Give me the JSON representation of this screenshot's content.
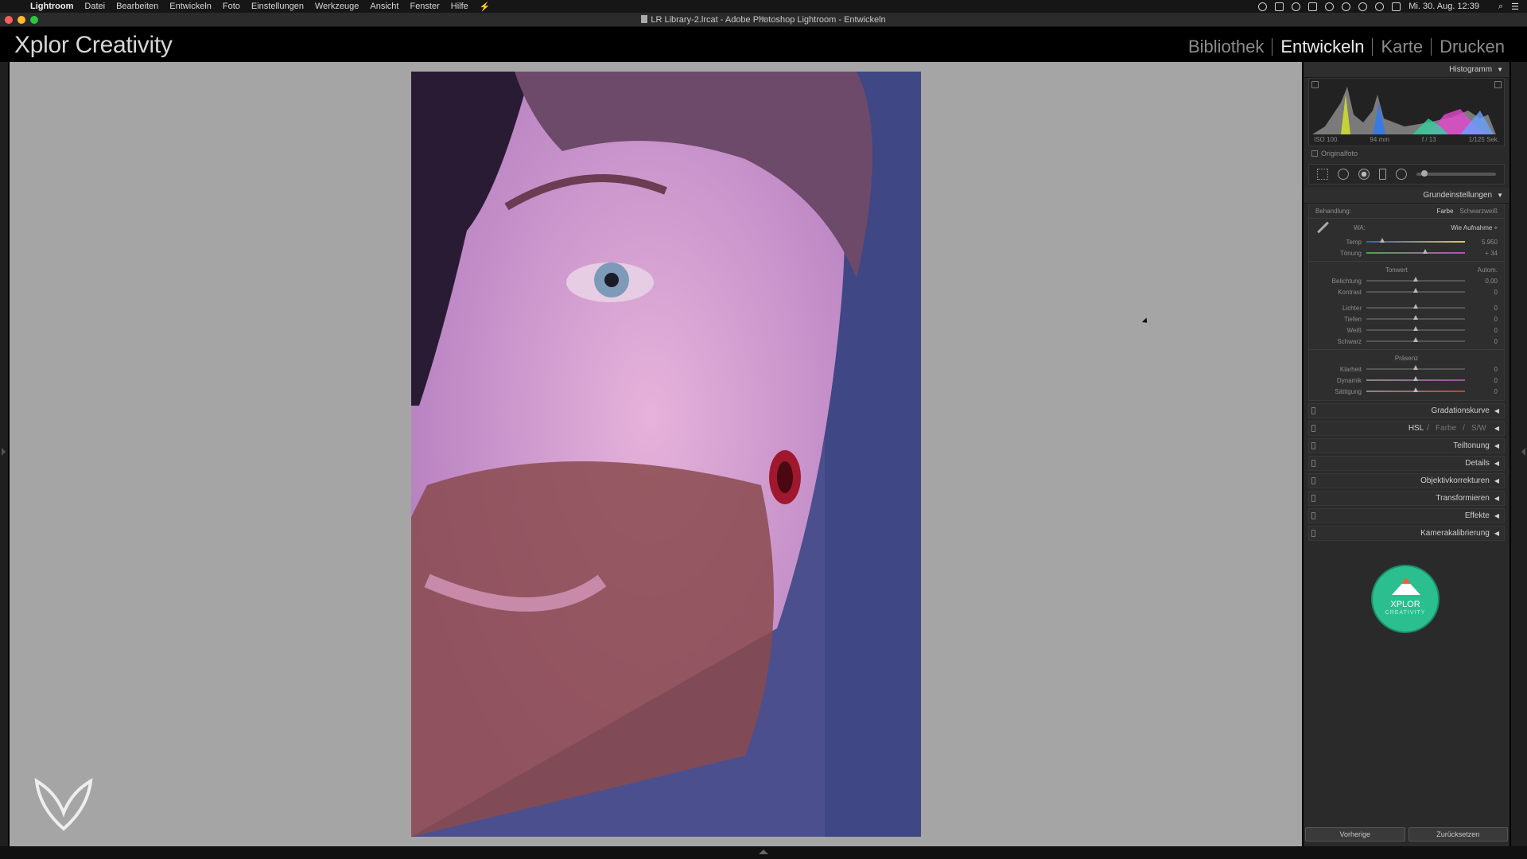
{
  "menubar": {
    "app": "Lightroom",
    "items": [
      "Datei",
      "Bearbeiten",
      "Entwickeln",
      "Foto",
      "Einstellungen",
      "Werkzeuge",
      "Ansicht",
      "Fenster",
      "Hilfe"
    ],
    "clock": "Mi. 30. Aug. 12:39"
  },
  "window": {
    "title": "LR Library-2.lrcat - Adobe Photoshop Lightroom - Entwickeln"
  },
  "identity": {
    "brand": "Xplor Creativity",
    "modules": [
      {
        "label": "Bibliothek",
        "active": false
      },
      {
        "label": "Entwickeln",
        "active": true
      },
      {
        "label": "Karte",
        "active": false
      },
      {
        "label": "Drucken",
        "active": false
      }
    ]
  },
  "histogram": {
    "header": "Histogramm",
    "iso": "ISO 100",
    "focal": "94 mm",
    "aperture": "f / 13",
    "shutter": "1/125 Sek.",
    "original_label": "Originalfoto"
  },
  "basic": {
    "header": "Grundeinstellungen",
    "treatment_label": "Behandlung:",
    "treatment_color": "Farbe",
    "treatment_bw": "Schwarzweiß",
    "wb_label": "WA:",
    "wb_value": "Wie Aufnahme",
    "temp": {
      "label": "Temp",
      "value": "5.950",
      "level": 0.16
    },
    "tint": {
      "label": "Tönung",
      "value": "+ 34",
      "level": 0.6
    },
    "tone_label": "Tonwert",
    "auto_label": "Autom.",
    "exposure": {
      "label": "Belichtung",
      "value": "0,00",
      "level": 0.5
    },
    "contrast": {
      "label": "Kontrast",
      "value": "0",
      "level": 0.5
    },
    "highlights": {
      "label": "Lichter",
      "value": "0",
      "level": 0.5
    },
    "shadows": {
      "label": "Tiefen",
      "value": "0",
      "level": 0.5
    },
    "whites": {
      "label": "Weiß",
      "value": "0",
      "level": 0.5
    },
    "blacks": {
      "label": "Schwarz",
      "value": "0",
      "level": 0.5
    },
    "presence_label": "Präsenz",
    "clarity": {
      "label": "Klarheit",
      "value": "0",
      "level": 0.5
    },
    "vibrance": {
      "label": "Dynamik",
      "value": "0",
      "level": 0.5
    },
    "saturation": {
      "label": "Sättigung",
      "value": "0",
      "level": 0.5
    }
  },
  "panels": {
    "curve": "Gradationskurve",
    "hsl": "HSL",
    "hsl_color": "Farbe",
    "hsl_bw": "S/W",
    "split": "Teiltonung",
    "detail": "Details",
    "lens": "Objektivkorrekturen",
    "transform": "Transformieren",
    "effects": "Effekte",
    "calibration": "Kamerakalibrierung"
  },
  "badge": {
    "line1": "XPLOR",
    "line2": "CREATIVITY"
  },
  "buttons": {
    "previous": "Vorherige",
    "reset": "Zurücksetzen"
  },
  "colors": {
    "background": "#a5a5a5",
    "panel": "#2a2a2a",
    "badge": "#2bbf8f"
  }
}
